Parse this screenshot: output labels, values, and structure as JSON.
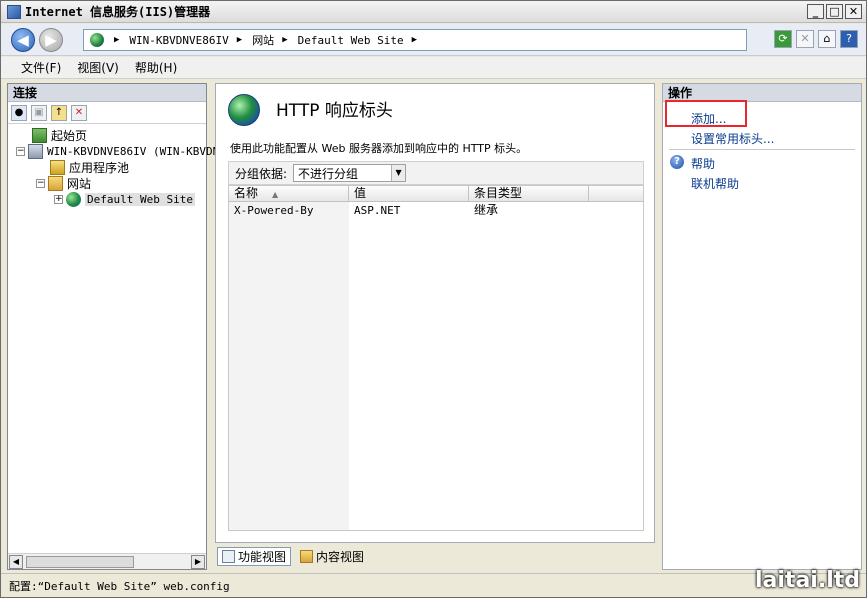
{
  "window": {
    "title": "Internet 信息服务(IIS)管理器",
    "controls": {
      "minimize": "_",
      "maximize": "□",
      "close": "✕"
    }
  },
  "address": {
    "crumbs": [
      "WIN-KBVDNVE86IV",
      "网站",
      "Default Web Site"
    ],
    "separator": "▶"
  },
  "menu": {
    "items": [
      "文件(F)",
      "视图(V)",
      "帮助(H)"
    ]
  },
  "connections": {
    "header": "连接",
    "tree": {
      "start_page": "起始页",
      "server": "WIN-KBVDNVE86IV (WIN-KBVDN",
      "app_pools": "应用程序池",
      "sites": "网站",
      "default_site": "Default Web Site"
    },
    "expander_minus": "−",
    "expander_plus": "+"
  },
  "feature": {
    "title": "HTTP 响应标头",
    "description": "使用此功能配置从 Web 服务器添加到响应中的 HTTP 标头。",
    "group_by_label": "分组依据:",
    "group_by_value": "不进行分组",
    "columns": {
      "name": "名称",
      "value": "值",
      "type": "条目类型"
    },
    "rows": [
      {
        "name": "X-Powered-By",
        "value": "ASP.NET",
        "type": "继承"
      }
    ]
  },
  "view_tabs": {
    "features": "功能视图",
    "content": "内容视图"
  },
  "actions": {
    "header": "操作",
    "add": "添加...",
    "set_common": "设置常用标头...",
    "help": "帮助",
    "online_help": "联机帮助"
  },
  "status": {
    "text": "配置:“Default Web Site” web.config"
  },
  "watermark": "laitai.ltd",
  "colors": {
    "highlight": "#e8262c",
    "link": "#0a3c8d"
  }
}
